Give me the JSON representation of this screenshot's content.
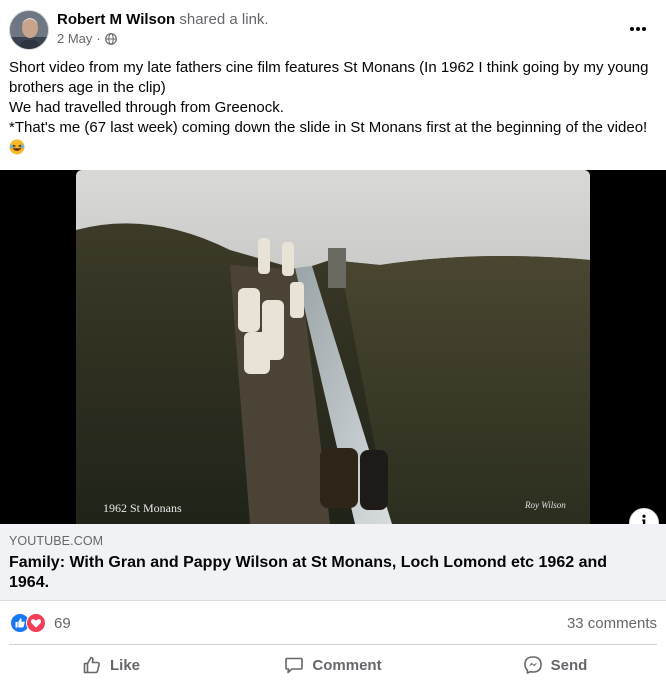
{
  "post": {
    "author": "Robert M Wilson",
    "action": "shared a link.",
    "date": "2 May",
    "separator": "·",
    "audience_icon": "globe-icon",
    "more_icon": "more-horizontal-icon",
    "text_lines": [
      "Short video from my late fathers cine film features St Monans (In 1962 I think going by my young brothers age in the clip)",
      "We had travelled through from Greenock.",
      "*That's me (67 last week) coming down the slide in St Monans first at the beginning of the video!"
    ],
    "emoji": "laughing-emoji-icon"
  },
  "video": {
    "caption_left": "1962 St Monans",
    "caption_right": "Roy Wilson",
    "info_icon": "info-icon",
    "info_label": "i"
  },
  "link": {
    "domain": "YOUTUBE.COM",
    "title": "Family: With Gran and Pappy Wilson at St Monans, Loch Lomond etc 1962 and 1964."
  },
  "engagement": {
    "reaction_icons": [
      "like-reaction-icon",
      "love-reaction-icon"
    ],
    "reaction_count": "69",
    "comments": "33 comments"
  },
  "actions": {
    "like": "Like",
    "comment": "Comment",
    "send": "Send"
  },
  "colors": {
    "like_blue": "#1877f2",
    "love_red": "#f33e58",
    "secondary_text": "#65676b",
    "card_bg": "#f0f2f5"
  }
}
